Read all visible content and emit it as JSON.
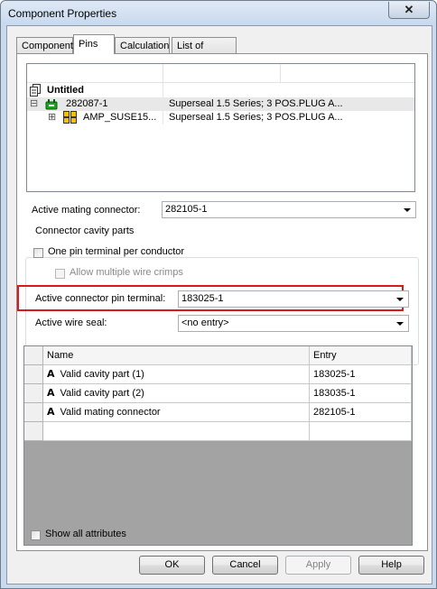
{
  "window": {
    "title": "Component Properties",
    "close_glyph": "✕"
  },
  "tabs": [
    {
      "label": "Component"
    },
    {
      "label": "Pins"
    },
    {
      "label": "Calculation"
    },
    {
      "label": "List of Values"
    }
  ],
  "tree": {
    "root_label": "Untitled",
    "rows": [
      {
        "expander": "⊟",
        "name": "282087-1",
        "desc": "Superseal 1.5 Series; 3 POS.PLUG A..."
      },
      {
        "expander": "⊞",
        "name": "AMP_SUSE15...",
        "desc": "Superseal 1.5 Series; 3 POS.PLUG A..."
      }
    ]
  },
  "active_mating_connector": {
    "label": "Active mating connector:",
    "value": "282105-1"
  },
  "cavity_parts": {
    "legend": "Connector cavity parts",
    "one_pin_label": "One pin terminal per conductor",
    "allow_multiple_label": "Allow multiple wire crimps",
    "pin_terminal_label": "Active connector pin terminal:",
    "pin_terminal_value": "183025-1",
    "wire_seal_label": "Active wire seal:",
    "wire_seal_value": "<no entry>"
  },
  "grid": {
    "headers": {
      "name": "Name",
      "entry": "Entry"
    },
    "rows": [
      {
        "icon": "A",
        "name": "Valid cavity part (1)",
        "entry": "183025-1"
      },
      {
        "icon": "A",
        "name": "Valid cavity part (2)",
        "entry": "183035-1"
      },
      {
        "icon": "A",
        "name": "Valid mating connector",
        "entry": "282105-1"
      }
    ]
  },
  "show_all_attributes_label": "Show all attributes",
  "buttons": {
    "ok": "OK",
    "cancel": "Cancel",
    "apply": "Apply",
    "help": "Help"
  },
  "colors": {
    "highlight": "#d9191c",
    "plug_icon": "#1fa21f",
    "connector_icon": "#f2c200"
  }
}
